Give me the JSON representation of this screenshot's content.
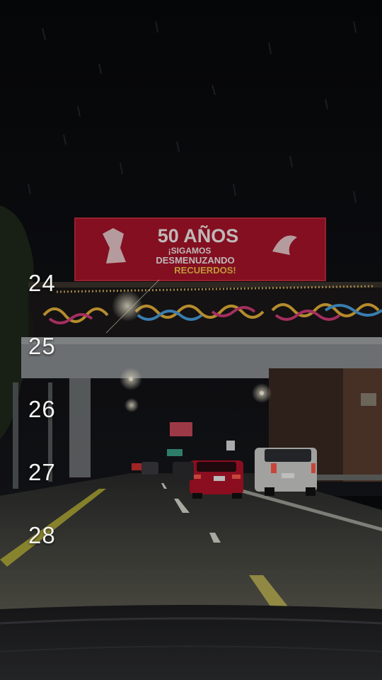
{
  "billboard": {
    "headline": "50 AÑOS",
    "line1": "¡SIGAMOS",
    "line2": "DESMENUZANDO",
    "line3": "RECUERDOS!"
  },
  "date_picker": {
    "items": [
      "24",
      "25",
      "26",
      "27",
      "28"
    ]
  },
  "colors": {
    "billboard_red": "#a8142a",
    "sky": "#0a0b0d",
    "text": "#f4f4f2"
  }
}
